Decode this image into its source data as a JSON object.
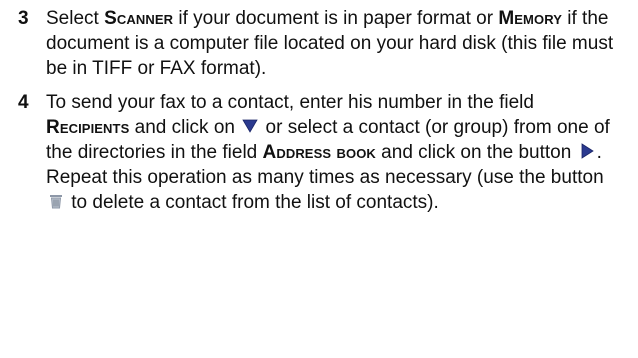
{
  "steps": [
    {
      "number": "3",
      "segments": [
        {
          "type": "text",
          "value": "Select "
        },
        {
          "type": "kw",
          "value": "Scanner"
        },
        {
          "type": "text",
          "value": " if your document is in paper format or "
        },
        {
          "type": "kw",
          "value": "Memory"
        },
        {
          "type": "text",
          "value": " if the document is a computer file located on your hard disk (this file must be in TIFF or FAX format)."
        }
      ]
    },
    {
      "number": "4",
      "segments": [
        {
          "type": "text",
          "value": "To send your fax to a contact, enter his number in the field "
        },
        {
          "type": "kw",
          "value": "Recipients"
        },
        {
          "type": "text",
          "value": " and click on "
        },
        {
          "type": "icon",
          "icon": "down-arrow-icon"
        },
        {
          "type": "text",
          "value": " or select a contact (or group) from one of the directories in the field "
        },
        {
          "type": "kw",
          "value": "Address book"
        },
        {
          "type": "text",
          "value": " and click on the button "
        },
        {
          "type": "icon",
          "icon": "right-arrow-icon"
        },
        {
          "type": "text",
          "value": ". Repeat this operation as many times as necessary (use the button "
        },
        {
          "type": "icon",
          "icon": "trash-icon"
        },
        {
          "type": "text",
          "value": " to delete a contact from the list of contacts)."
        }
      ]
    }
  ],
  "colors": {
    "text": "#111111",
    "arrow_icon": "#2b3a8f",
    "trash_icon": "#8e98a8"
  }
}
